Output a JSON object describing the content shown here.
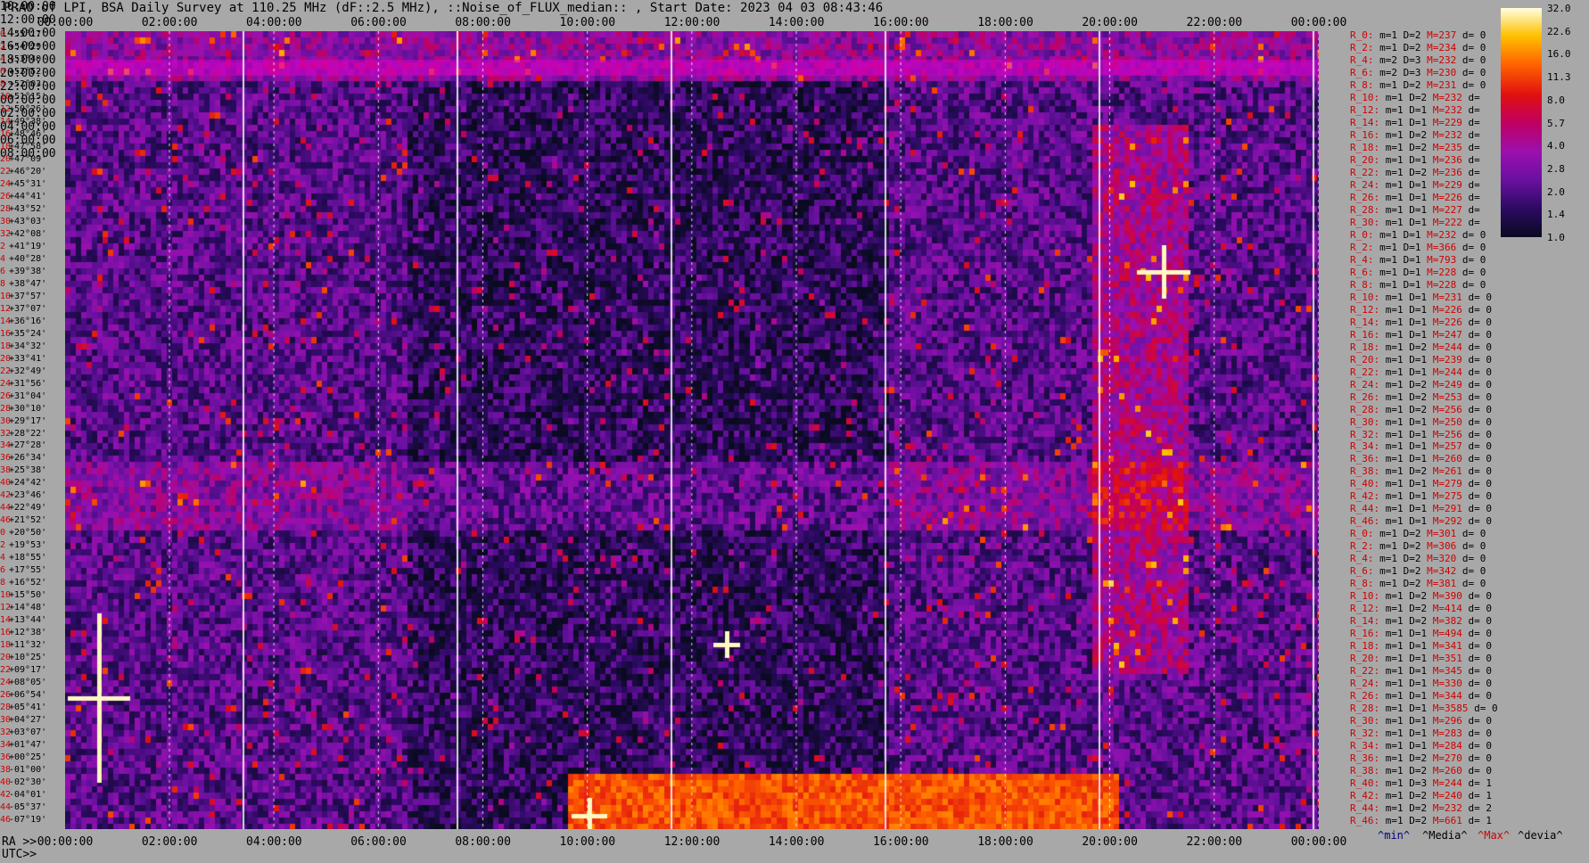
{
  "title": "PRAO of LPI, BSA Daily Survey at 110.25 MHz (dF::2.5 MHz), ::Noise_of_FLUX_median:: , Start Date: 2023 04 03 08:43:46",
  "top_ticks": [
    "00:00:00",
    "02:00:00",
    "04:00:00",
    "06:00:00",
    "08:00:00",
    "10:00:00",
    "12:00:00",
    "14:00:00",
    "16:00:00",
    "18:00:00",
    "20:00:00",
    "22:00:00",
    "00:00:00"
  ],
  "ra_prefix": "RA >>",
  "ra_ticks": [
    "00:00:00",
    "02:00:00",
    "04:00:00",
    "06:00:00",
    "08:00:00",
    "10:00:00",
    "12:00:00",
    "14:00:00",
    "16:00:00",
    "18:00:00",
    "20:00:00",
    "22:00:00",
    "00:00:00"
  ],
  "utc_prefix": "UTC>>",
  "utc_ticks": [
    "10:00:00",
    "12:00:00",
    "14:00:00",
    "16:00:00",
    "18:00:00",
    "20:00:00",
    "22:00:00",
    "00:00:00",
    "02:00:00",
    "04:00:00",
    "06:00:00",
    "08:00:00"
  ],
  "dec_rows": [
    {
      "i": "0",
      "d": "+55°17'"
    },
    {
      "i": "2",
      "d": "+54°29'"
    },
    {
      "i": "4",
      "d": "+53°40'"
    },
    {
      "i": "6",
      "d": "+52°52'"
    },
    {
      "i": "8",
      "d": "+52°03'"
    },
    {
      "i": "10",
      "d": "+51°15'"
    },
    {
      "i": "12",
      "d": "+50°26'"
    },
    {
      "i": "14",
      "d": "+49°38'"
    },
    {
      "i": "16",
      "d": "+48°46'"
    },
    {
      "i": "18",
      "d": "+47°58'"
    },
    {
      "i": "20",
      "d": "+47°09'"
    },
    {
      "i": "22",
      "d": "+46°20'"
    },
    {
      "i": "24",
      "d": "+45°31'"
    },
    {
      "i": "26",
      "d": "+44°41'"
    },
    {
      "i": "28",
      "d": "+43°52'"
    },
    {
      "i": "30",
      "d": "+43°03'"
    },
    {
      "i": "32",
      "d": "+42°08'"
    },
    {
      "i": "2",
      "d": "+41°19'"
    },
    {
      "i": "4",
      "d": "+40°28'"
    },
    {
      "i": "6",
      "d": "+39°38'"
    },
    {
      "i": "8",
      "d": "+38°47'"
    },
    {
      "i": "10",
      "d": "+37°57'"
    },
    {
      "i": "12",
      "d": "+37°07'"
    },
    {
      "i": "14",
      "d": "+36°16'"
    },
    {
      "i": "16",
      "d": "+35°24'"
    },
    {
      "i": "18",
      "d": "+34°32'"
    },
    {
      "i": "20",
      "d": "+33°41'"
    },
    {
      "i": "22",
      "d": "+32°49'"
    },
    {
      "i": "24",
      "d": "+31°56'"
    },
    {
      "i": "26",
      "d": "+31°04'"
    },
    {
      "i": "28",
      "d": "+30°10'"
    },
    {
      "i": "30",
      "d": "+29°17'"
    },
    {
      "i": "32",
      "d": "+28°22'"
    },
    {
      "i": "34",
      "d": "+27°28'"
    },
    {
      "i": "36",
      "d": "+26°34'"
    },
    {
      "i": "38",
      "d": "+25°38'"
    },
    {
      "i": "40",
      "d": "+24°42'"
    },
    {
      "i": "42",
      "d": "+23°46'"
    },
    {
      "i": "44",
      "d": "+22°49'"
    },
    {
      "i": "46",
      "d": "+21°52'"
    },
    {
      "i": "0",
      "d": "+20°50'"
    },
    {
      "i": "2",
      "d": "+19°53'"
    },
    {
      "i": "4",
      "d": "+18°55'"
    },
    {
      "i": "6",
      "d": "+17°55'"
    },
    {
      "i": "8",
      "d": "+16°52'"
    },
    {
      "i": "10",
      "d": "+15°50'"
    },
    {
      "i": "12",
      "d": "+14°48'"
    },
    {
      "i": "14",
      "d": "+13°44'"
    },
    {
      "i": "16",
      "d": "+12°38'"
    },
    {
      "i": "18",
      "d": "+11°32'"
    },
    {
      "i": "20",
      "d": "+10°25'"
    },
    {
      "i": "22",
      "d": "+09°17'"
    },
    {
      "i": "24",
      "d": "+08°05'"
    },
    {
      "i": "26",
      "d": "+06°54'"
    },
    {
      "i": "28",
      "d": "+05°41'"
    },
    {
      "i": "30",
      "d": "+04°27'"
    },
    {
      "i": "32",
      "d": "+03°07'"
    },
    {
      "i": "34",
      "d": "+01°47'"
    },
    {
      "i": "36",
      "d": "+00°25'"
    },
    {
      "i": "38",
      "d": "-01°00'"
    },
    {
      "i": "40",
      "d": "-02°30'"
    },
    {
      "i": "42",
      "d": "-04°01'"
    },
    {
      "i": "44",
      "d": "-05°37'"
    },
    {
      "i": "46",
      "d": "-07°19'"
    }
  ],
  "stats": [
    {
      "r": "R_0:",
      "m": "1",
      "D": "2",
      "M": "237",
      "d": "0"
    },
    {
      "r": "R_2:",
      "m": "1",
      "D": "2",
      "M": "234",
      "d": "0"
    },
    {
      "r": "R_4:",
      "m": "2",
      "D": "3",
      "M": "232",
      "d": "0"
    },
    {
      "r": "R_6:",
      "m": "2",
      "D": "3",
      "M": "230",
      "d": "0"
    },
    {
      "r": "R_8:",
      "m": "1",
      "D": "2",
      "M": "231",
      "d": "0"
    },
    {
      "r": "R_10:",
      "m": "1",
      "D": "2",
      "M": "232",
      "d": ""
    },
    {
      "r": "R_12:",
      "m": "1",
      "D": "1",
      "M": "232",
      "d": ""
    },
    {
      "r": "R_14:",
      "m": "1",
      "D": "1",
      "M": "229",
      "d": ""
    },
    {
      "r": "R_16:",
      "m": "1",
      "D": "2",
      "M": "232",
      "d": ""
    },
    {
      "r": "R_18:",
      "m": "1",
      "D": "2",
      "M": "235",
      "d": ""
    },
    {
      "r": "R_20:",
      "m": "1",
      "D": "1",
      "M": "236",
      "d": ""
    },
    {
      "r": "R_22:",
      "m": "1",
      "D": "2",
      "M": "236",
      "d": ""
    },
    {
      "r": "R_24:",
      "m": "1",
      "D": "1",
      "M": "229",
      "d": ""
    },
    {
      "r": "R_26:",
      "m": "1",
      "D": "1",
      "M": "226",
      "d": ""
    },
    {
      "r": "R_28:",
      "m": "1",
      "D": "1",
      "M": "227",
      "d": ""
    },
    {
      "r": "R_30:",
      "m": "1",
      "D": "1",
      "M": "222",
      "d": ""
    },
    {
      "r": "R_0:",
      "m": "1",
      "D": "1",
      "M": "232",
      "d": "0"
    },
    {
      "r": "R_2:",
      "m": "1",
      "D": "1",
      "M": "366",
      "d": "0"
    },
    {
      "r": "R_4:",
      "m": "1",
      "D": "1",
      "M": "793",
      "d": "0"
    },
    {
      "r": "R_6:",
      "m": "1",
      "D": "1",
      "M": "228",
      "d": "0"
    },
    {
      "r": "R_8:",
      "m": "1",
      "D": "1",
      "M": "228",
      "d": "0"
    },
    {
      "r": "R_10:",
      "m": "1",
      "D": "1",
      "M": "231",
      "d": "0"
    },
    {
      "r": "R_12:",
      "m": "1",
      "D": "1",
      "M": "226",
      "d": "0"
    },
    {
      "r": "R_14:",
      "m": "1",
      "D": "1",
      "M": "226",
      "d": "0"
    },
    {
      "r": "R_16:",
      "m": "1",
      "D": "1",
      "M": "247",
      "d": "0"
    },
    {
      "r": "R_18:",
      "m": "1",
      "D": "2",
      "M": "244",
      "d": "0"
    },
    {
      "r": "R_20:",
      "m": "1",
      "D": "1",
      "M": "239",
      "d": "0"
    },
    {
      "r": "R_22:",
      "m": "1",
      "D": "1",
      "M": "244",
      "d": "0"
    },
    {
      "r": "R_24:",
      "m": "1",
      "D": "2",
      "M": "249",
      "d": "0"
    },
    {
      "r": "R_26:",
      "m": "1",
      "D": "2",
      "M": "253",
      "d": "0"
    },
    {
      "r": "R_28:",
      "m": "1",
      "D": "2",
      "M": "256",
      "d": "0"
    },
    {
      "r": "R_30:",
      "m": "1",
      "D": "1",
      "M": "250",
      "d": "0"
    },
    {
      "r": "R_32:",
      "m": "1",
      "D": "1",
      "M": "256",
      "d": "0"
    },
    {
      "r": "R_34:",
      "m": "1",
      "D": "1",
      "M": "257",
      "d": "0"
    },
    {
      "r": "R_36:",
      "m": "1",
      "D": "1",
      "M": "260",
      "d": "0"
    },
    {
      "r": "R_38:",
      "m": "1",
      "D": "2",
      "M": "261",
      "d": "0"
    },
    {
      "r": "R_40:",
      "m": "1",
      "D": "1",
      "M": "279",
      "d": "0"
    },
    {
      "r": "R_42:",
      "m": "1",
      "D": "1",
      "M": "275",
      "d": "0"
    },
    {
      "r": "R_44:",
      "m": "1",
      "D": "1",
      "M": "291",
      "d": "0"
    },
    {
      "r": "R_46:",
      "m": "1",
      "D": "1",
      "M": "292",
      "d": "0"
    },
    {
      "r": "R_0:",
      "m": "1",
      "D": "2",
      "M": "301",
      "d": "0"
    },
    {
      "r": "R_2:",
      "m": "1",
      "D": "2",
      "M": "306",
      "d": "0"
    },
    {
      "r": "R_4:",
      "m": "1",
      "D": "2",
      "M": "320",
      "d": "0"
    },
    {
      "r": "R_6:",
      "m": "1",
      "D": "2",
      "M": "342",
      "d": "0"
    },
    {
      "r": "R_8:",
      "m": "1",
      "D": "2",
      "M": "381",
      "d": "0"
    },
    {
      "r": "R_10:",
      "m": "1",
      "D": "2",
      "M": "390",
      "d": "0"
    },
    {
      "r": "R_12:",
      "m": "1",
      "D": "2",
      "M": "414",
      "d": "0"
    },
    {
      "r": "R_14:",
      "m": "1",
      "D": "2",
      "M": "382",
      "d": "0"
    },
    {
      "r": "R_16:",
      "m": "1",
      "D": "1",
      "M": "494",
      "d": "0"
    },
    {
      "r": "R_18:",
      "m": "1",
      "D": "1",
      "M": "341",
      "d": "0"
    },
    {
      "r": "R_20:",
      "m": "1",
      "D": "1",
      "M": "351",
      "d": "0"
    },
    {
      "r": "R_22:",
      "m": "1",
      "D": "1",
      "M": "345",
      "d": "0"
    },
    {
      "r": "R_24:",
      "m": "1",
      "D": "1",
      "M": "330",
      "d": "0"
    },
    {
      "r": "R_26:",
      "m": "1",
      "D": "1",
      "M": "344",
      "d": "0"
    },
    {
      "r": "R_28:",
      "m": "1",
      "D": "1",
      "M": "3585",
      "d": "0"
    },
    {
      "r": "R_30:",
      "m": "1",
      "D": "1",
      "M": "296",
      "d": "0"
    },
    {
      "r": "R_32:",
      "m": "1",
      "D": "1",
      "M": "283",
      "d": "0"
    },
    {
      "r": "R_34:",
      "m": "1",
      "D": "1",
      "M": "284",
      "d": "0"
    },
    {
      "r": "R_36:",
      "m": "1",
      "D": "2",
      "M": "270",
      "d": "0"
    },
    {
      "r": "R_38:",
      "m": "1",
      "D": "2",
      "M": "260",
      "d": "0"
    },
    {
      "r": "R_40:",
      "m": "1",
      "D": "3",
      "M": "244",
      "d": "1"
    },
    {
      "r": "R_42:",
      "m": "1",
      "D": "2",
      "M": "240",
      "d": "1"
    },
    {
      "r": "R_44:",
      "m": "1",
      "D": "2",
      "M": "232",
      "d": "2"
    },
    {
      "r": "R_46:",
      "m": "1",
      "D": "2",
      "M": "661",
      "d": "1"
    }
  ],
  "colorbar_ticks": [
    "32.0",
    "22.6",
    "16.0",
    "11.3",
    "8.0",
    "5.7",
    "4.0",
    "2.8",
    "2.0",
    "1.4",
    "1.0"
  ],
  "legend": {
    "min": "^min^",
    "median": "^Media^",
    "max": "^Max^",
    "devia": "^devia^"
  },
  "chart_data": {
    "type": "heatmap",
    "title": "PRAO of LPI, BSA Daily Survey at 110.25 MHz (dF::2.5 MHz), ::Noise_of_FLUX_median:: , Start Date: 2023 04 03 08:43:46",
    "x_axis_top": "RA 00:00:00 to 00:00:00",
    "y_axis": "Declination +55°17' to -07°19'",
    "colorbar_range": [
      1.0,
      32.0
    ],
    "colorbar_scale": "log2"
  }
}
